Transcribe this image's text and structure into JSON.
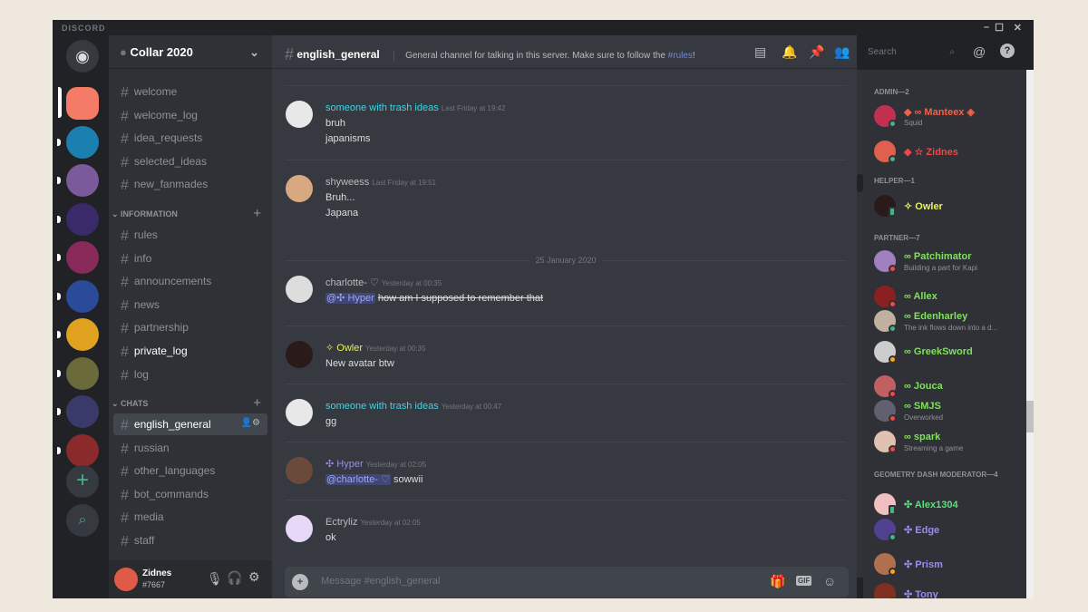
{
  "app": {
    "title": "DISCORD"
  },
  "server": {
    "name": "Collar 2020"
  },
  "channels": {
    "top": [
      "welcome",
      "welcome_log",
      "idea_requests",
      "selected_ideas",
      "new_fanmades"
    ],
    "information": {
      "label": "INFORMATION",
      "items": [
        "rules",
        "info",
        "announcements",
        "news",
        "partnership",
        "private_log",
        "log"
      ]
    },
    "chats": {
      "label": "CHATS",
      "items": [
        "english_general",
        "russian",
        "other_languages",
        "bot_commands",
        "media",
        "staff"
      ]
    },
    "selected": "english_general"
  },
  "user": {
    "name": "Zidnes",
    "tag": "#7667"
  },
  "header": {
    "channel": "english_general",
    "topic_prefix": "General channel for talking in this server. Make sure to follow the ",
    "topic_link": "#rules",
    "topic_suffix": "!",
    "search_placeholder": "Search"
  },
  "messages": [
    {
      "author": "someone with trash ideas",
      "color": "#3fd5e6",
      "time": "Last Friday at 19:42",
      "lines": [
        "bruh",
        "japanisms"
      ]
    },
    {
      "author": "shyweess",
      "color": "#b9bbbe",
      "time": "Last Friday at 19:51",
      "lines": [
        "Bruh...",
        "Japana"
      ]
    },
    {
      "author": "charlotte- ♡",
      "color": "#b9bbbe",
      "time": "Yesterday at 00:35",
      "mention": "@✣ Hyper",
      "strike": "how am I supposed to remember that"
    },
    {
      "author": "✧ Owler",
      "color": "#e8f05a",
      "time": "Yesterday at 00:35",
      "lines": [
        "New avatar btw"
      ]
    },
    {
      "author": "someone with trash ideas",
      "color": "#3fd5e6",
      "time": "Yesterday at 00:47",
      "lines": [
        "gg"
      ]
    },
    {
      "author": "✣ Hyper",
      "color": "#9a8cf0",
      "time": "Yesterday at 02:05",
      "mention": "@charlotte- ♡",
      "text": " sowwii"
    },
    {
      "author": "Ectryliz",
      "color": "#b9bbbe",
      "time": "Yesterday at 02:05",
      "lines": [
        "ok"
      ]
    }
  ],
  "date_divider": "25 January 2020",
  "input": {
    "placeholder": "Message #english_general"
  },
  "members": {
    "groups": [
      {
        "label": "ADMIN—2",
        "members": [
          {
            "name": "◆ ∞ Manteex ◈",
            "color": "#f0604a",
            "sub": "Squid",
            "status": "online"
          },
          {
            "name": "◆ ☆ Zidnes",
            "color": "#f04747",
            "sub": "",
            "status": "online"
          }
        ]
      },
      {
        "label": "HELPER—1",
        "members": [
          {
            "name": "✧ Owler",
            "color": "#e8f05a",
            "sub": "",
            "status": "mobile"
          }
        ]
      },
      {
        "label": "PARTNER—7",
        "members": [
          {
            "name": "∞ Patchimator",
            "color": "#7ee25a",
            "sub": "Building a part for Kapi",
            "status": "dnd"
          },
          {
            "name": "∞ Allex",
            "color": "#7ee25a",
            "sub": "",
            "status": "dnd"
          },
          {
            "name": "∞ Edenharley",
            "color": "#7ee25a",
            "sub": "The ink flows down into a d...",
            "status": "online"
          },
          {
            "name": "∞ GreekSword",
            "color": "#7ee25a",
            "sub": "",
            "status": "idle"
          },
          {
            "name": "∞ Jouca",
            "color": "#7ee25a",
            "sub": "",
            "status": "dnd"
          },
          {
            "name": "∞ SMJS",
            "color": "#7ee25a",
            "sub": "Overworked",
            "status": "dnd"
          },
          {
            "name": "∞ spark",
            "color": "#7ee25a",
            "sub": "Streaming a game",
            "status": "dnd"
          }
        ]
      },
      {
        "label": "GEOMETRY DASH MODERATOR—4",
        "members": [
          {
            "name": "✣ Alex1304",
            "color": "#5ae07a",
            "sub": "",
            "status": "mobile"
          },
          {
            "name": "✣ Edge",
            "color": "#9a8cf0",
            "sub": "",
            "status": "online"
          },
          {
            "name": "✣ Prism",
            "color": "#9a8cf0",
            "sub": "",
            "status": "idle"
          },
          {
            "name": "✣ Tony",
            "color": "#9a8cf0",
            "sub": "",
            "status": "idle"
          }
        ]
      }
    ]
  },
  "colors": {
    "online": "#43b581",
    "idle": "#faa61a",
    "dnd": "#f04747",
    "mobile": "#43b581",
    "accent": "#7289da"
  }
}
